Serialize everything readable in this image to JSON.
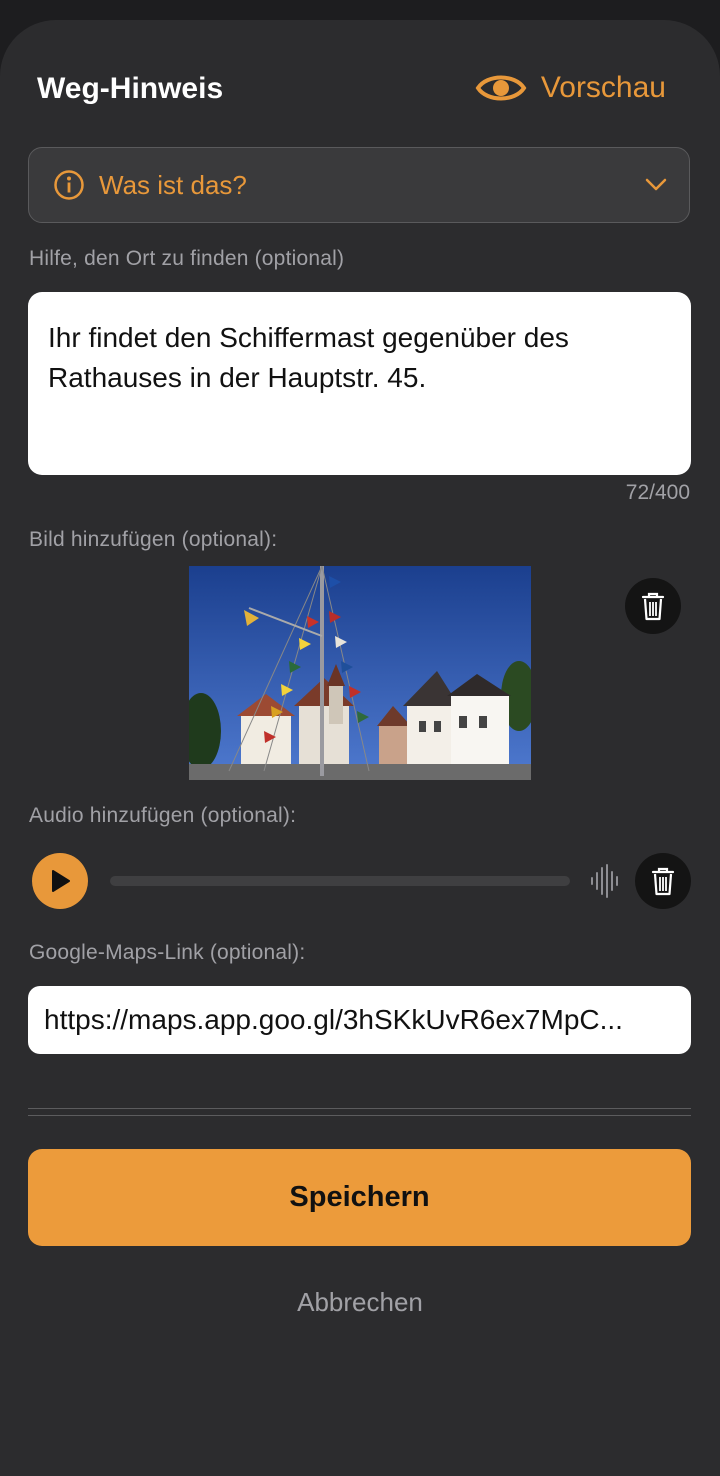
{
  "header": {
    "title": "Weg-Hinweis",
    "preview_label": "Vorschau"
  },
  "info": {
    "label": "Was ist das?"
  },
  "hint": {
    "label": "Hilfe, den Ort zu finden (optional)",
    "value": "Ihr findet den Schiffermast gegenüber des Rathauses in der Hauptstr. 45.",
    "counter": "72/400"
  },
  "image_section": {
    "label": "Bild hinzufügen (optional):"
  },
  "audio_section": {
    "label": "Audio hinzufügen (optional):",
    "progress": 0
  },
  "maps": {
    "label": "Google-Maps-Link (optional):",
    "value": "https://maps.app.goo.gl/3hSKkUvR6ex7MpC..."
  },
  "actions": {
    "save_label": "Speichern",
    "cancel_label": "Abbrechen"
  },
  "colors": {
    "accent": "#ec9b3b",
    "background": "#2c2c2e",
    "muted_text": "#a1a1a6"
  },
  "icons": [
    "eye-icon",
    "info-icon",
    "chevron-down-icon",
    "trash-icon",
    "play-icon",
    "waveform-icon"
  ]
}
